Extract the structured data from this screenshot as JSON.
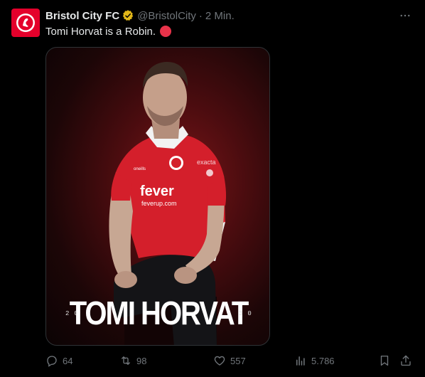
{
  "account": {
    "name": "Bristol City FC",
    "handle": "@BristolCity",
    "separator": "·",
    "time": "2 Min."
  },
  "tweet": {
    "text": "Tomi Horvat is a Robin."
  },
  "media": {
    "title": "TOMI HORVAT",
    "year_left": "20",
    "year_right": "30",
    "sponsor_main": "fever",
    "sponsor_sub": "feverup.com",
    "sleeve_sponsor": "exacta",
    "kit_brand": "oneills"
  },
  "actions": {
    "replies": "64",
    "retweets": "98",
    "likes": "557",
    "views": "5.786"
  },
  "colors": {
    "background": "#000000",
    "club_red": "#e4002b",
    "muted": "#71767b",
    "text": "#e7e9ea",
    "verified_gold": "#e2b719"
  },
  "icons": [
    "club-crest-icon",
    "verified-badge-icon",
    "more-icon",
    "reply-icon",
    "retweet-icon",
    "like-icon",
    "views-icon",
    "bookmark-icon",
    "share-icon"
  ]
}
